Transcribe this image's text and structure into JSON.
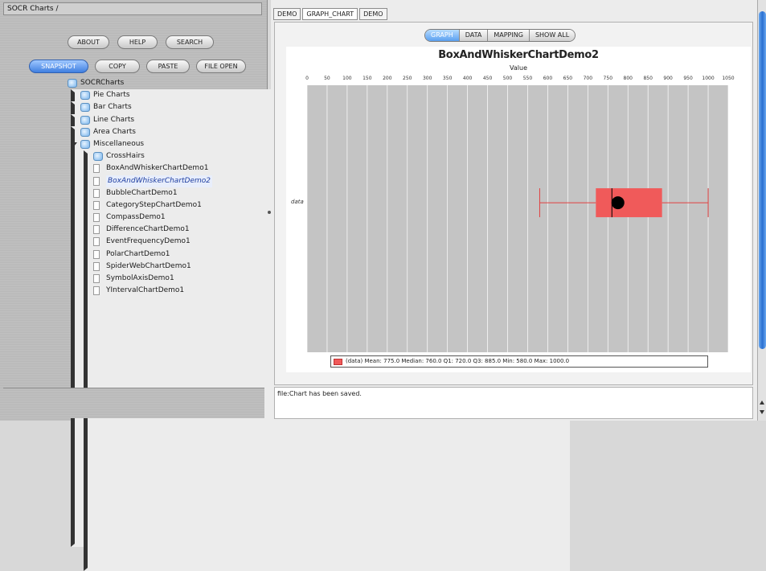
{
  "left": {
    "title": "SOCR Charts /",
    "buttons": [
      "ABOUT",
      "HELP",
      "SEARCH"
    ],
    "modes": [
      "SNAPSHOT",
      "COPY",
      "PASTE",
      "FILE OPEN"
    ],
    "tree": [
      {
        "label": "SOCRCharts",
        "kind": "folder",
        "indent": 0,
        "expander": ""
      },
      {
        "label": "Pie Charts",
        "kind": "folder",
        "indent": 1,
        "expander": "right"
      },
      {
        "label": "Bar Charts",
        "kind": "folder",
        "indent": 1,
        "expander": "right"
      },
      {
        "label": "Line Charts",
        "kind": "folder",
        "indent": 1,
        "expander": "right"
      },
      {
        "label": "Area Charts",
        "kind": "folder",
        "indent": 1,
        "expander": "right"
      },
      {
        "label": "Miscellaneous",
        "kind": "folder",
        "indent": 1,
        "expander": "down"
      },
      {
        "label": "CrossHairs",
        "kind": "folder",
        "indent": 2,
        "expander": "right"
      },
      {
        "label": "BoxAndWhiskerChartDemo1",
        "kind": "doc",
        "indent": 2,
        "expander": ""
      },
      {
        "label": "BoxAndWhiskerChartDemo2",
        "kind": "doc",
        "indent": 2,
        "expander": "",
        "selected": true
      },
      {
        "label": "BubbleChartDemo1",
        "kind": "doc",
        "indent": 2,
        "expander": ""
      },
      {
        "label": "CategoryStepChartDemo1",
        "kind": "doc",
        "indent": 2,
        "expander": ""
      },
      {
        "label": "CompassDemo1",
        "kind": "doc",
        "indent": 2,
        "expander": ""
      },
      {
        "label": "DifferenceChartDemo1",
        "kind": "doc",
        "indent": 2,
        "expander": ""
      },
      {
        "label": "EventFrequencyDemo1",
        "kind": "doc",
        "indent": 2,
        "expander": ""
      },
      {
        "label": "PolarChartDemo1",
        "kind": "doc",
        "indent": 2,
        "expander": ""
      },
      {
        "label": "SpiderWebChartDemo1",
        "kind": "doc",
        "indent": 2,
        "expander": ""
      },
      {
        "label": "SymbolAxisDemo1",
        "kind": "doc",
        "indent": 2,
        "expander": ""
      },
      {
        "label": "YIntervalChartDemo1",
        "kind": "doc",
        "indent": 2,
        "expander": ""
      }
    ]
  },
  "right": {
    "tabs": [
      "DEMO",
      "GRAPH_CHART",
      "DEMO"
    ],
    "views": [
      "GRAPH",
      "DATA",
      "MAPPING",
      "SHOW ALL"
    ],
    "selected_view": "GRAPH",
    "console_text": "file:Chart has been saved."
  },
  "chart_data": {
    "type": "box",
    "title": "BoxAndWhiskerChartDemo2",
    "xlabel": "Value",
    "orientation": "horizontal",
    "xlim": [
      0,
      1050
    ],
    "ticks": [
      0,
      50,
      100,
      150,
      200,
      250,
      300,
      350,
      400,
      450,
      500,
      550,
      600,
      650,
      700,
      750,
      800,
      850,
      900,
      950,
      1000,
      1050
    ],
    "categories": [
      "data"
    ],
    "box": {
      "min": 580,
      "q1": 720,
      "median": 760,
      "mean": 775,
      "q3": 885,
      "max": 1000
    },
    "box_color": "#f05a5a",
    "whisker_color": "#e04040",
    "mean_color": "#000000",
    "plot_bg": "#c4c4c4",
    "grid": true,
    "legend": "(data) Mean: 775.0 Median: 760.0 Q1: 720.0 Q3: 885.0 Min: 580.0 Max: 1000.0"
  }
}
